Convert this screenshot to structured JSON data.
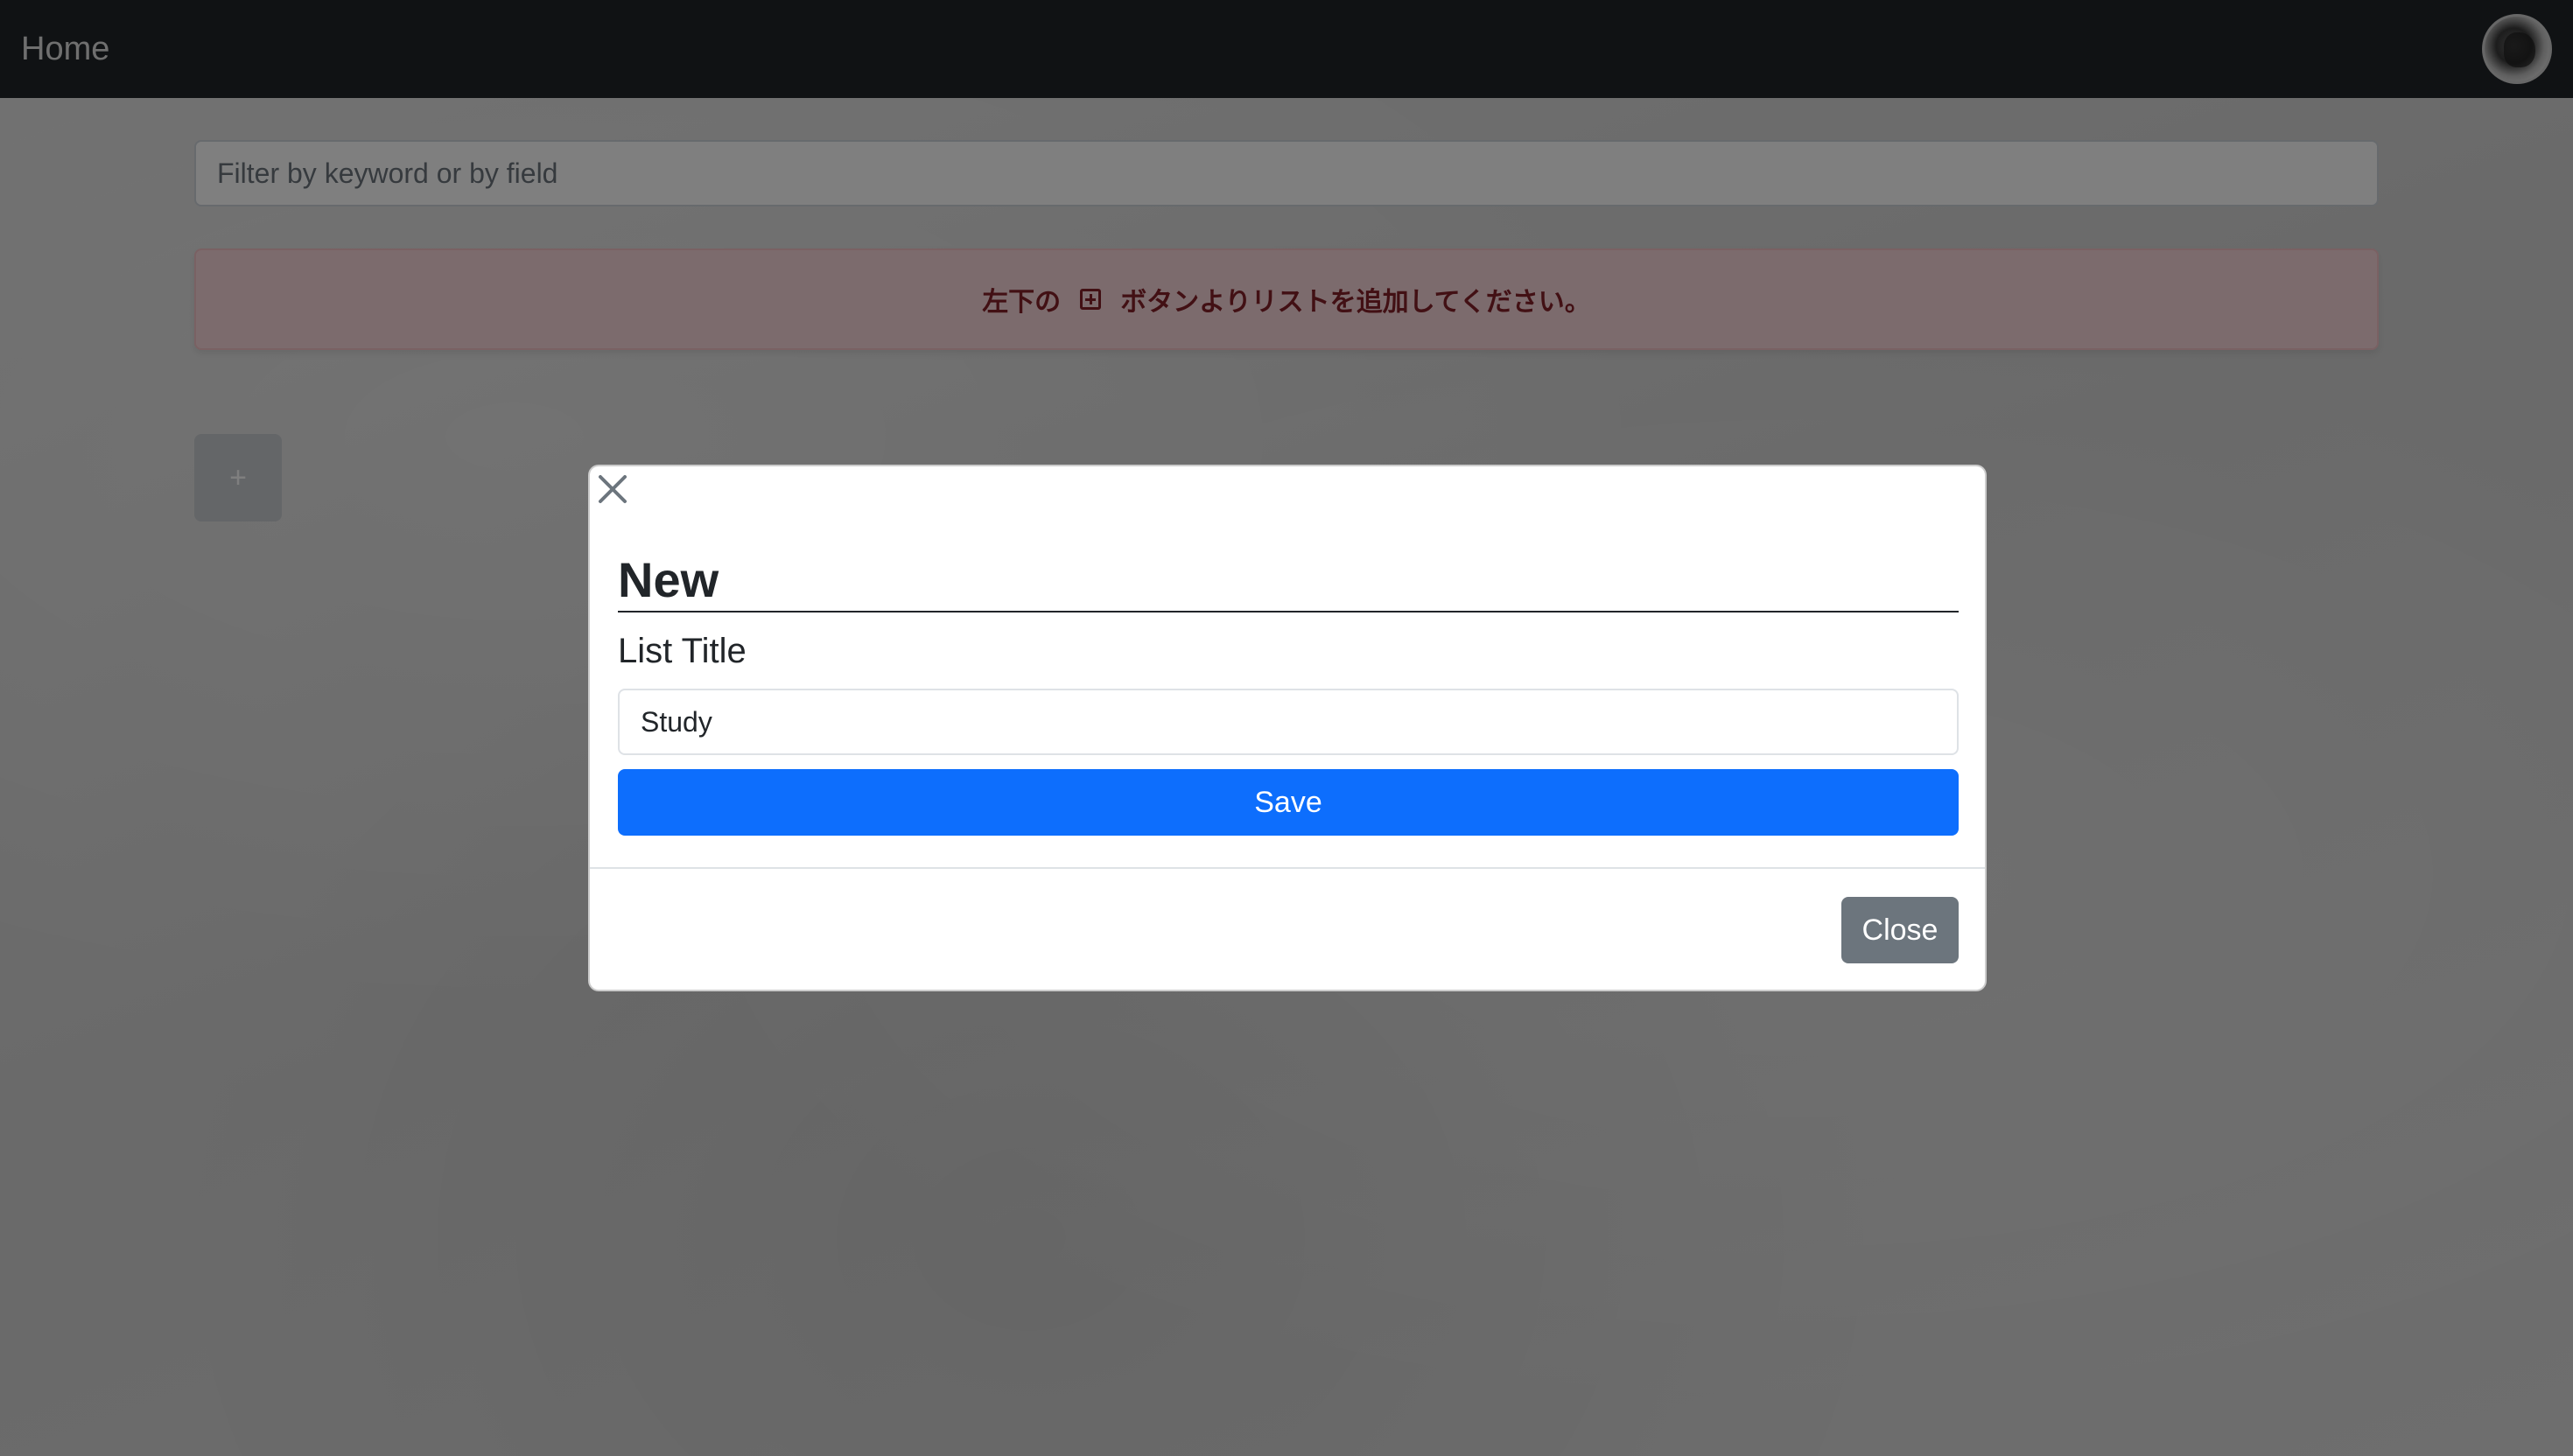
{
  "navbar": {
    "brand": "Home",
    "avatar_icon": "user-avatar-icon"
  },
  "filter": {
    "placeholder": "Filter by keyword or by field",
    "value": ""
  },
  "alert": {
    "text_before": "左下の",
    "icon": "plus-square-icon",
    "text_after": "ボタンよりリストを追加してください。"
  },
  "add_list_button": {
    "label": "+"
  },
  "modal": {
    "close_icon": "close-icon",
    "title": "New",
    "field_label": "List Title",
    "input_value": "Study",
    "save_label": "Save",
    "close_label": "Close"
  },
  "colors": {
    "navbar_bg": "#212529",
    "alert_bg": "#f8d7da",
    "alert_text": "#842029",
    "primary": "#0d6efd",
    "secondary": "#6c757d"
  }
}
